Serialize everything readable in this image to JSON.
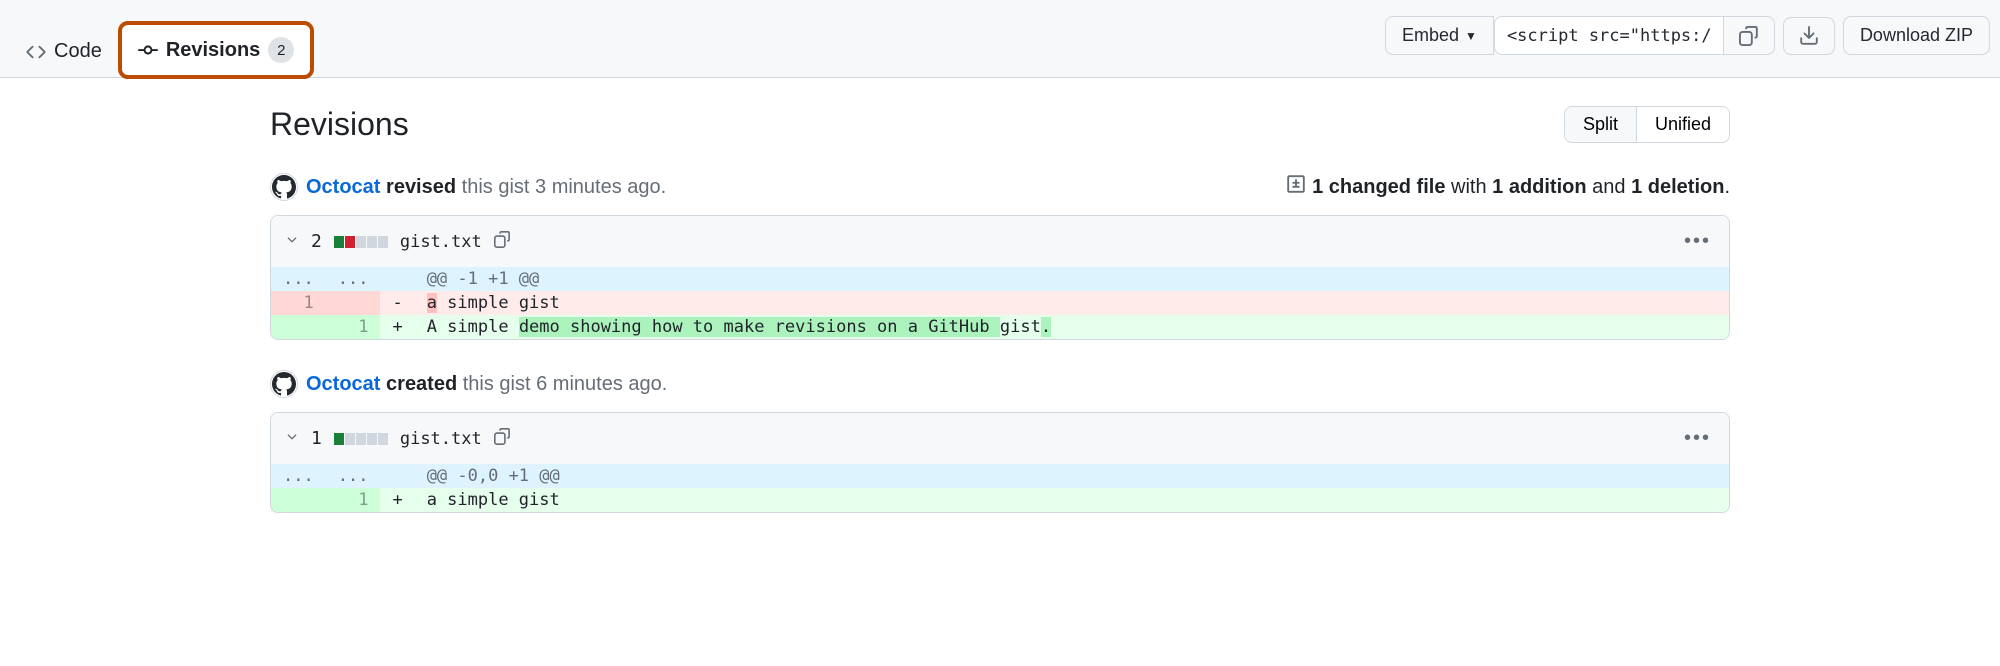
{
  "tabs": {
    "code": "Code",
    "revisions": "Revisions",
    "revisions_count": "2"
  },
  "toolbar": {
    "embed": "Embed",
    "script_snippet": "<script src=\"https://",
    "download_zip": "Download ZIP"
  },
  "page_title": "Revisions",
  "view_toggle": {
    "split": "Split",
    "unified": "Unified"
  },
  "revisions": [
    {
      "user": "Octocat",
      "action": "revised",
      "object": "this gist",
      "time": "3 minutes ago",
      "summary": {
        "files": "1 changed file",
        "with": " with ",
        "additions": "1 addition",
        "and": " and ",
        "deletions": "1 deletion"
      },
      "file": {
        "change_count": "2",
        "name": "gist.txt",
        "stat_pattern": "add,rm,none,none,none"
      },
      "hunk": "@@ -1 +1 @@",
      "lines": [
        {
          "type": "del",
          "old_no": "1",
          "new_no": "",
          "marker": "-",
          "prefix": "",
          "hl": "a",
          "suffix": " simple gist"
        },
        {
          "type": "add",
          "old_no": "",
          "new_no": "1",
          "marker": "+",
          "prefix": "A simple ",
          "hl": "demo showing how to make revisions on a GitHub ",
          "suffix": "gist",
          "tail_hl": "."
        }
      ]
    },
    {
      "user": "Octocat",
      "action": "created",
      "object": "this gist",
      "time": "6 minutes ago",
      "file": {
        "change_count": "1",
        "name": "gist.txt",
        "stat_pattern": "add,none,none,none,none"
      },
      "hunk": "@@ -0,0 +1 @@",
      "lines": [
        {
          "type": "add",
          "old_no": "",
          "new_no": "1",
          "marker": "+",
          "prefix": "a simple gist",
          "hl": "",
          "suffix": ""
        }
      ]
    }
  ]
}
